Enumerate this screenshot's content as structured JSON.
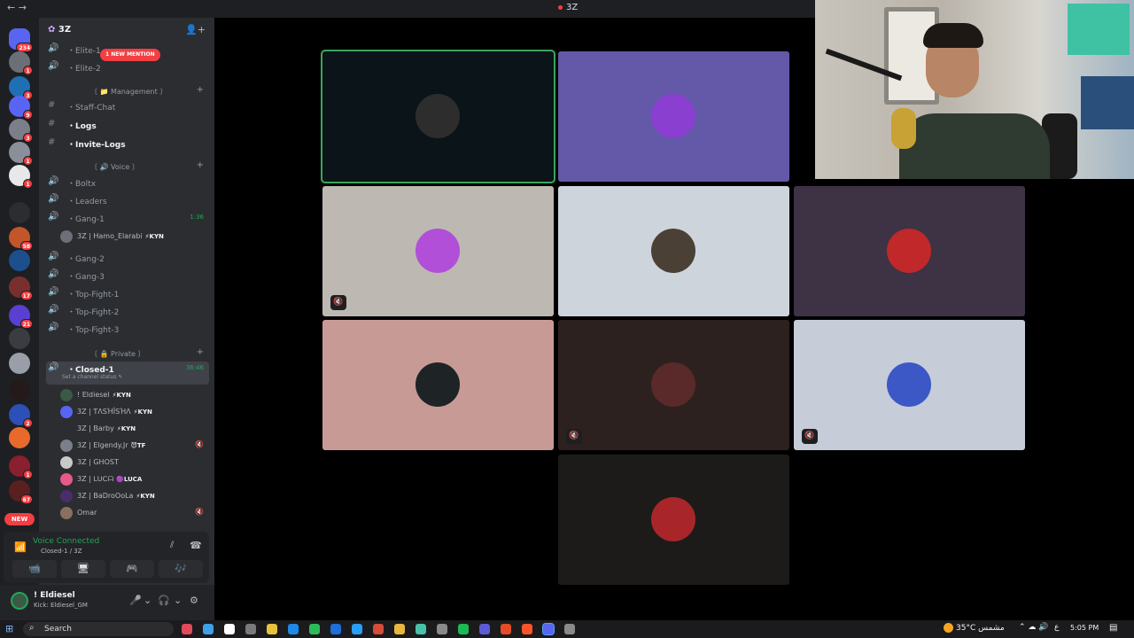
{
  "titlebar": {
    "title": "3Z",
    "back_glyph": "←  →"
  },
  "servers": {
    "items": [
      {
        "name": "direct-messages",
        "color": "#5865f2",
        "badge": "234"
      },
      {
        "name": "server-1",
        "color": "#6d6f78",
        "badge": "1"
      },
      {
        "name": "server-2",
        "color": "#1f6fb5",
        "badge": "3"
      },
      {
        "name": "server-3",
        "color": "#5865f2",
        "badge": "9"
      },
      {
        "name": "server-4",
        "color": "#7a7f8a",
        "badge": "3"
      },
      {
        "name": "server-5",
        "color": "#8a8f99",
        "badge": "1"
      },
      {
        "name": "server-6",
        "color": "#e8e8e8",
        "badge": "1"
      },
      {
        "name": "server-7",
        "color": "#2b2d31",
        "badge": ""
      },
      {
        "name": "server-8",
        "color": "#c2552a",
        "badge": "58"
      },
      {
        "name": "server-9",
        "color": "#1d4f8c",
        "badge": ""
      },
      {
        "name": "server-10",
        "color": "#7a2f2f",
        "badge": "17"
      },
      {
        "name": "server-11",
        "color": "#5b3fd1",
        "badge": "21"
      },
      {
        "name": "server-12",
        "color": "#3a3c42",
        "badge": ""
      },
      {
        "name": "server-13",
        "color": "#9a9ea8",
        "badge": ""
      },
      {
        "name": "server-14",
        "color": "#241a1a",
        "badge": ""
      },
      {
        "name": "server-15",
        "color": "#2c4fb8",
        "badge": "2"
      },
      {
        "name": "server-16",
        "color": "#e86a2a",
        "badge": ""
      },
      {
        "name": "server-17",
        "color": "#8a1f2f",
        "badge": "1"
      },
      {
        "name": "server-18",
        "color": "#5a2020",
        "badge": "67"
      }
    ],
    "new_label": "NEW"
  },
  "guild": {
    "name": "3Z",
    "mention_pill": "1 NEW MENTION"
  },
  "channels": {
    "top": [
      {
        "label": "・Elite-1",
        "icon": "🔊",
        "bold": false
      },
      {
        "label": "・Elite-2",
        "icon": "🔊",
        "bold": false
      }
    ],
    "cat_management": "〔 📁 Management 〕",
    "management": [
      {
        "label": "・Staff-Chat",
        "icon": "#",
        "bold": false
      },
      {
        "label": "・Logs",
        "icon": "#",
        "bold": true
      },
      {
        "label": "・Invite-Logs",
        "icon": "#",
        "bold": true
      }
    ],
    "cat_voice": "〔 🔊 Voice 〕",
    "voice": [
      {
        "label": "・Boltx",
        "icon": "🔊",
        "bold": false
      },
      {
        "label": "・Leaders",
        "icon": "🔊",
        "bold": false
      },
      {
        "label": "・Gang-1",
        "icon": "🔊",
        "bold": false,
        "meta": "1:36"
      }
    ],
    "gang1_user": {
      "name": "3Z | Hamo_Elarabi",
      "tag": "⚡KYN"
    },
    "voice2": [
      {
        "label": "・Gang-2",
        "icon": "🔊",
        "bold": false
      },
      {
        "label": "・Gang-3",
        "icon": "🔊",
        "bold": false
      },
      {
        "label": "・Top-Fight-1",
        "icon": "🔊",
        "bold": false
      },
      {
        "label": "・Top-Fight-2",
        "icon": "🔊",
        "bold": false
      },
      {
        "label": "・Top-Fight-3",
        "icon": "🔊",
        "bold": false
      }
    ],
    "cat_private": "〔 🔒 Private 〕",
    "active": {
      "label": "・Closed-1",
      "meta": "36:46",
      "status": "Set a channel status ✎"
    },
    "closed_users": [
      {
        "name": "! Eldiesel",
        "tag": "⚡KYN",
        "color": "#3a5a45",
        "mute": ""
      },
      {
        "name": "3Z | ƬΛЅΉЇЅΉΛ",
        "tag": "⚡KYN",
        "color": "#5865f2",
        "mute": ""
      },
      {
        "name": "3Z | Barby",
        "tag": "⚡KYN",
        "color": "#2b2d31",
        "mute": ""
      },
      {
        "name": "3Z | Elgendy.Jr",
        "tag": "😈TF",
        "color": "#7a7f8a",
        "mute": "🔇"
      },
      {
        "name": "3Z | GHOST",
        "tag": "",
        "color": "#c9c9c9",
        "mute": ""
      },
      {
        "name": "3Z | ᒪᑌᑕᗩ",
        "tag": "🟣LUCA",
        "color": "#e65a8a",
        "mute": ""
      },
      {
        "name": "3Z | BaDroOoLa",
        "tag": "⚡KYN",
        "color": "#4a2d6b",
        "mute": ""
      },
      {
        "name": "Omar",
        "tag": "",
        "color": "#8a6f5f",
        "mute": "🔇"
      }
    ]
  },
  "voice_panel": {
    "status": "Voice Connected",
    "channel": "Closed-1 / 3Z",
    "buttons": [
      "📹",
      "🖥",
      "🎮",
      "🎶"
    ]
  },
  "user_panel": {
    "name": "! Eldiesel",
    "status": "Kick: Eldiesel_GM"
  },
  "tiles": [
    {
      "bg": "#0b1418",
      "avatar": "#2d2d2d",
      "muted": false,
      "speaking": true
    },
    {
      "bg": "#6359a8",
      "avatar": "#8a3fd1",
      "muted": false,
      "speaking": false
    },
    {
      "bg": "#bdb8b2",
      "avatar": "#b14fd9",
      "muted": true,
      "speaking": false
    },
    {
      "bg": "#cdd4dc",
      "avatar": "#4a4036",
      "muted": false,
      "speaking": false
    },
    {
      "bg": "#3e3245",
      "avatar": "#c0282a",
      "muted": false,
      "speaking": false
    },
    {
      "bg": "#c89a96",
      "avatar": "#1e2426",
      "muted": false,
      "speaking": false
    },
    {
      "bg": "#2c211e",
      "avatar": "#5a2a2a",
      "muted": true,
      "speaking": false
    },
    {
      "bg": "#c7ccd9",
      "avatar": "#3b58c6",
      "muted": true,
      "speaking": false
    },
    {
      "bg": "#1d1b19",
      "avatar": "#a8262a",
      "muted": false,
      "speaking": false
    }
  ],
  "taskbar": {
    "search": "Search",
    "weather_temp": "35°C",
    "weather_text": "مشمس",
    "lang": "ع",
    "time": "5:05 PM",
    "apps": [
      "#e04a5a",
      "#3fa0e8",
      "#ffffff",
      "#7a7a7a",
      "#e8c23a",
      "#1e88e5",
      "#2dbb5a",
      "#1e6fd9",
      "#2a9df4",
      "#d64b3a",
      "#e9b73f",
      "#46c2a8",
      "#8a8a8a",
      "#1db954",
      "#5b5bd6",
      "#e34c26",
      "#fb542b",
      "#5865f2",
      "#8a8a8a"
    ]
  }
}
